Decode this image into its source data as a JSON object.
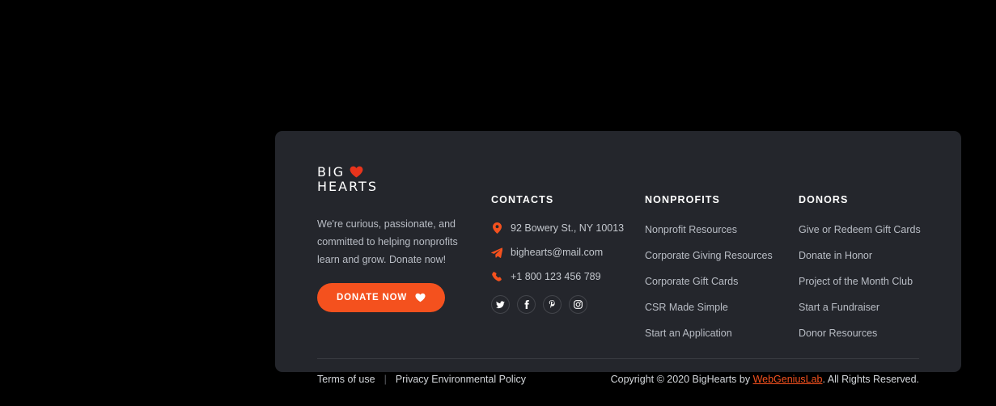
{
  "colors": {
    "page_background": "#000000",
    "card_background": "#24262c",
    "accent": "#f4511e",
    "heading": "#ffffff",
    "body_text": "#b9bdc5",
    "divider": "#393b41"
  },
  "brand": {
    "logo_line1": "BIG",
    "logo_line2": "HEARTS",
    "logo_icon": "heart-icon",
    "description": "We're curious, passionate, and committed to helping nonprofits learn and grow. Donate now!",
    "donate_label": "DONATE NOW",
    "donate_icon": "heart-icon"
  },
  "contacts": {
    "heading": "CONTACTS",
    "items": [
      {
        "icon": "map-pin-icon",
        "text": "92 Bowery St., NY 10013"
      },
      {
        "icon": "paper-plane-icon",
        "text": "bighearts@mail.com"
      },
      {
        "icon": "phone-icon",
        "text": "+1 800 123 456 789"
      }
    ],
    "socials": [
      {
        "name": "twitter",
        "label": "Twitter"
      },
      {
        "name": "facebook",
        "label": "Facebook"
      },
      {
        "name": "pinterest",
        "label": "Pinterest"
      },
      {
        "name": "instagram",
        "label": "Instagram"
      }
    ]
  },
  "nonprofits": {
    "heading": "NONPROFITS",
    "links": [
      "Nonprofit Resources",
      "Corporate Giving Resources",
      "Corporate Gift Cards",
      "CSR Made Simple",
      "Start an Application"
    ]
  },
  "donors": {
    "heading": "DONORS",
    "links": [
      "Give or Redeem Gift Cards",
      "Donate in Honor",
      "Project of the Month Club",
      "Start a Fundraiser",
      "Donor Resources"
    ]
  },
  "bottom": {
    "terms_label": "Terms of use",
    "separator": "|",
    "privacy_label": "Privacy Environmental Policy",
    "copyright_prefix": "Copyright © 2020 BigHearts by ",
    "copyright_link": "WebGeniusLab",
    "copyright_suffix": ". All Rights Reserved."
  }
}
